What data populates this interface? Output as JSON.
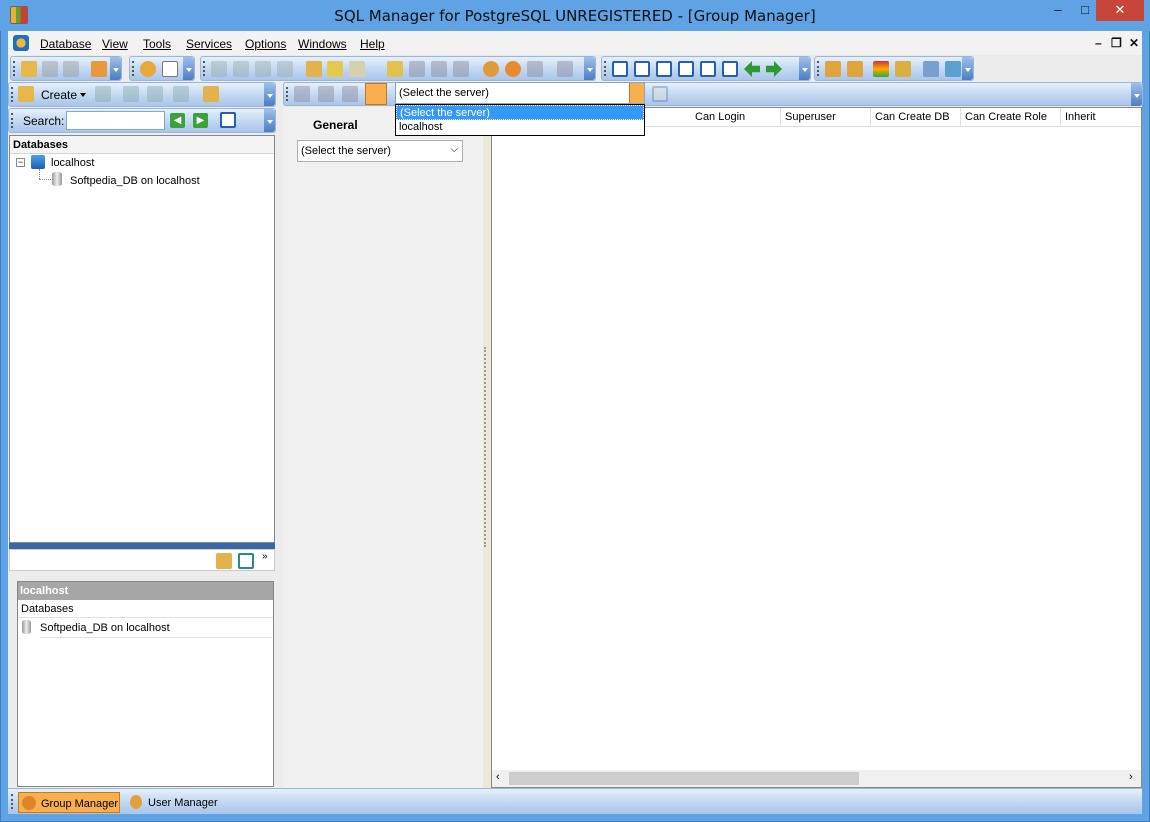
{
  "window": {
    "title": "SQL Manager for PostgreSQL UNREGISTERED - [Group Manager]",
    "minimize": "–",
    "maximize": "□",
    "close": "✕"
  },
  "menu": {
    "items": [
      "Database",
      "View",
      "Tools",
      "Services",
      "Options",
      "Windows",
      "Help"
    ]
  },
  "mdi": {
    "minimize": "–",
    "restore": "❐",
    "close": "✕"
  },
  "left": {
    "create_label": "Create",
    "search_label": "Search:",
    "search_value": "",
    "tree_header": "Databases",
    "tree_nodes": [
      "localhost",
      "Softpedia_DB on localhost"
    ],
    "lower_header": "localhost",
    "lower_section": "Databases",
    "lower_item": "Softpedia_DB on localhost"
  },
  "middle": {
    "general_label": "General",
    "server_select": "(Select the server)"
  },
  "toolbar_select": {
    "value": "(Select the server)",
    "options": [
      "(Select the server)",
      "localhost"
    ]
  },
  "grid": {
    "columns": [
      "Can Login",
      "Superuser",
      "Can Create DB",
      "Can Create Role",
      "Inherit"
    ]
  },
  "status": {
    "tabs": [
      "Group Manager",
      "User Manager"
    ]
  },
  "colors": {
    "accent": "#f9b04c",
    "titlebar": "#5fa3e4",
    "selection": "#3399ff"
  }
}
